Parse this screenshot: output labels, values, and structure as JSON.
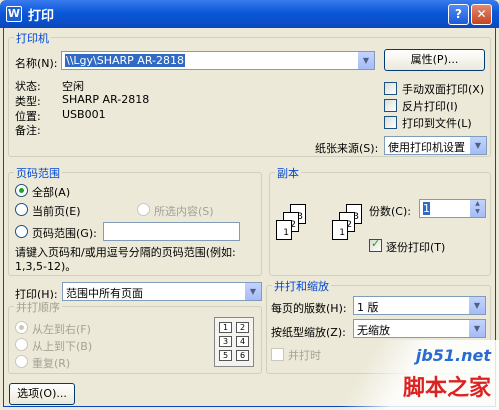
{
  "window": {
    "title": "打印",
    "icon_letter": "W"
  },
  "printer_group": {
    "label": "打印机",
    "name_label": "名称(N):",
    "name_value": "\\\\Lgy\\SHARP AR-2818",
    "properties_button": "属性(P)...",
    "status_label": "状态:",
    "status_value": "空闲",
    "type_label": "类型:",
    "type_value": "SHARP AR-2818",
    "location_label": "位置:",
    "location_value": "USB001",
    "comment_label": "备注:",
    "manual_duplex": "手动双面打印(X)",
    "reverse_print": "反片打印(I)",
    "print_to_file": "打印到文件(L)",
    "paper_source_label": "纸张来源(S):",
    "paper_source_value": "使用打印机设置"
  },
  "page_range_group": {
    "label": "页码范围",
    "all": "全部(A)",
    "current_page": "当前页(E)",
    "selection": "所选内容(S)",
    "pages": "页码范围(G):",
    "hint_line1": "请键入页码和/或用逗号分隔的页码范围(例如:",
    "hint_line2": "1,3,5-12)。"
  },
  "copies_group": {
    "label": "副本",
    "copies_label": "份数(C):",
    "copies_value": "1",
    "collate": "逐份打印(T)"
  },
  "print_what": {
    "label": "打印(H):",
    "value": "范围中所有页面"
  },
  "order_group": {
    "label": "并打顺序",
    "left_to_right": "从左到右(F)",
    "top_to_bottom": "从上到下(B)",
    "repeat": "重复(R)",
    "cells": [
      "1",
      "2",
      "3",
      "4",
      "5",
      "6"
    ]
  },
  "zoom_group": {
    "label": "并打和缩放",
    "pages_per_sheet_label": "每页的版数(H):",
    "pages_per_sheet_value": "1 版",
    "scale_label": "按纸型缩放(Z):",
    "scale_value": "无缩放",
    "print_check_label": "并打时"
  },
  "options_button": "选项(O)...",
  "watermark": {
    "text1": "jb51.net",
    "text2": "脚本之家"
  }
}
